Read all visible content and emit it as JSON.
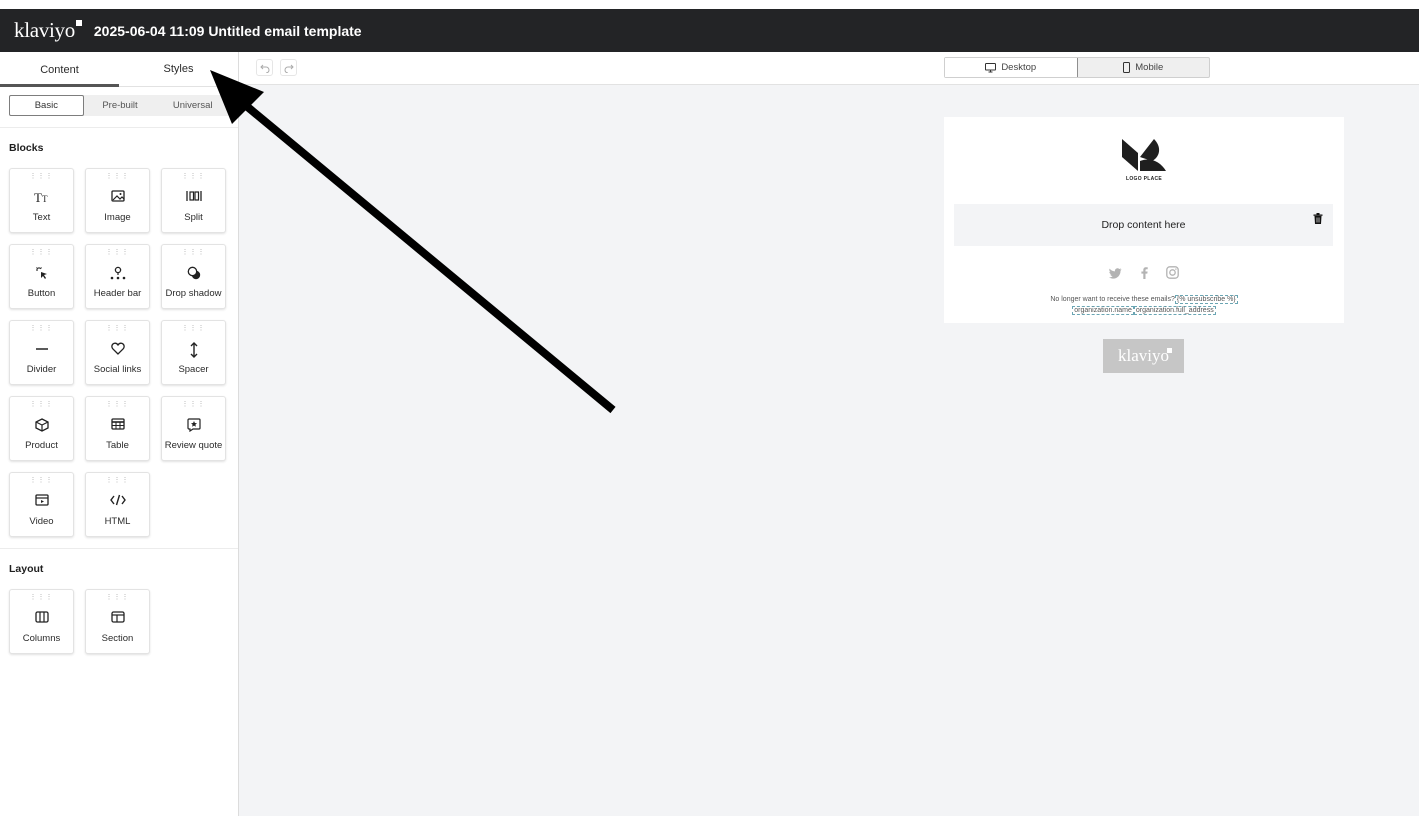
{
  "header": {
    "logo": "klaviyo",
    "title": "2025-06-04 11:09 Untitled email template"
  },
  "sidebar": {
    "tabs": [
      {
        "label": "Content"
      },
      {
        "label": "Styles"
      }
    ],
    "segments": [
      {
        "label": "Basic"
      },
      {
        "label": "Pre-built"
      },
      {
        "label": "Universal"
      }
    ],
    "blocks_title": "Blocks",
    "blocks": [
      {
        "label": "Text",
        "icon": "text-icon"
      },
      {
        "label": "Image",
        "icon": "image-icon"
      },
      {
        "label": "Split",
        "icon": "split-icon"
      },
      {
        "label": "Button",
        "icon": "cursor-click-icon"
      },
      {
        "label": "Header bar",
        "icon": "header-bar-icon"
      },
      {
        "label": "Drop shadow",
        "icon": "drop-shadow-icon"
      },
      {
        "label": "Divider",
        "icon": "divider-icon"
      },
      {
        "label": "Social links",
        "icon": "heart-icon"
      },
      {
        "label": "Spacer",
        "icon": "spacer-icon"
      },
      {
        "label": "Product",
        "icon": "box-icon"
      },
      {
        "label": "Table",
        "icon": "table-icon"
      },
      {
        "label": "Review quote",
        "icon": "review-star-icon"
      },
      {
        "label": "Video",
        "icon": "video-icon"
      },
      {
        "label": "HTML",
        "icon": "code-icon"
      }
    ],
    "layout_title": "Layout",
    "layout": [
      {
        "label": "Columns",
        "icon": "columns-icon"
      },
      {
        "label": "Section",
        "icon": "section-icon"
      }
    ]
  },
  "toolbar": {
    "desktop_label": "Desktop",
    "mobile_label": "Mobile"
  },
  "email": {
    "logo_text": "LOGO PLACE",
    "drop_text": "Drop content here",
    "footer_text": "No longer want to receive these emails?",
    "unsubscribe_tag": "{% unsubscribe %}",
    "org_name_tag": "organization.name",
    "org_address_tag": "organization.full_address"
  },
  "badge": {
    "text": "klaviyo"
  }
}
